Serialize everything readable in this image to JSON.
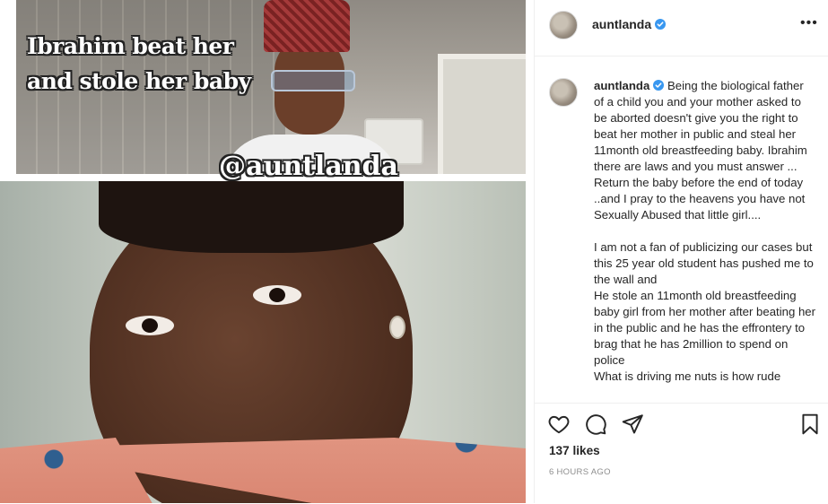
{
  "post": {
    "username": "auntlanda",
    "verified": true,
    "more_label": "•••",
    "media": {
      "overlay_title": "Ibrahim beat her and stole her baby",
      "overlay_handle": "@auntlanda"
    },
    "caption_username": "auntlanda",
    "caption_text": " Being the biological father of a child you and your mother asked to be aborted doesn't give you the right to beat her mother in public and steal her 11month old breastfeeding baby. Ibrahim there are laws and you must answer ... Return the baby before the end of today ..and I pray to the heavens you have not Sexually Abused that little girl....\n\nI am not a fan of publicizing our cases but this 25 year old student has pushed me to the wall and\nHe stole an 11month old breastfeeding baby girl from her mother after beating her in the public and he has the effrontery to brag that he has 2million to spend on police\nWhat is driving me nuts is how rude",
    "likes": "137 likes",
    "timestamp": "6 HOURS AGO",
    "icons": {
      "like": "heart-icon",
      "comment": "comment-icon",
      "share": "paper-plane-icon",
      "save": "bookmark-icon",
      "verified": "verified-badge-icon"
    },
    "colors": {
      "verified": "#3897f0",
      "text": "#262626",
      "muted": "#8e8e8e",
      "border": "#efefef"
    }
  }
}
